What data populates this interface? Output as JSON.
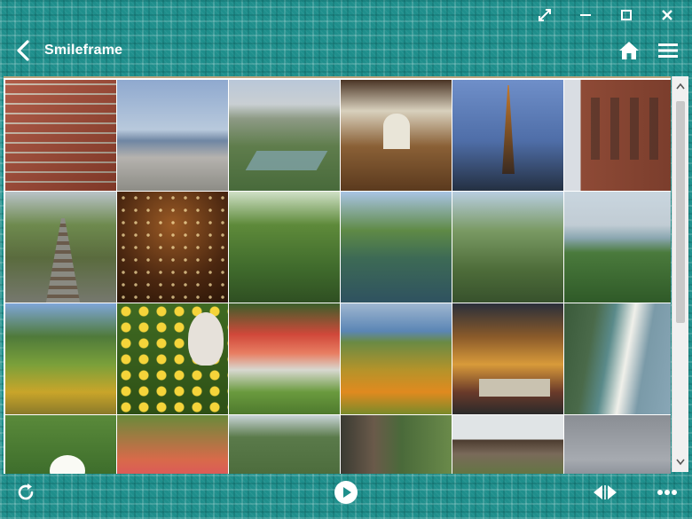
{
  "app": {
    "title": "Smileframe"
  },
  "window_controls": [
    {
      "name": "fullscreen-icon"
    },
    {
      "name": "minimize-icon"
    },
    {
      "name": "maximize-icon"
    },
    {
      "name": "close-icon"
    }
  ],
  "toolbar": [
    {
      "name": "home-icon"
    },
    {
      "name": "menu-icon"
    }
  ],
  "bottom_controls": [
    {
      "name": "refresh-icon"
    },
    {
      "name": "play-icon"
    },
    {
      "name": "prev-next-icon"
    },
    {
      "name": "more-icon"
    }
  ],
  "photos": [
    {
      "subject": "brick-wall"
    },
    {
      "subject": "city-bay-view"
    },
    {
      "subject": "star-fort-park"
    },
    {
      "subject": "wooden-hall-interior"
    },
    {
      "subject": "tv-tower-night"
    },
    {
      "subject": "red-brick-building"
    },
    {
      "subject": "railway-tracks"
    },
    {
      "subject": "lit-ceiling-interior"
    },
    {
      "subject": "forest-garden"
    },
    {
      "subject": "garden-pond"
    },
    {
      "subject": "weeping-tree"
    },
    {
      "subject": "coast-forest-view"
    },
    {
      "subject": "flower-bed-path"
    },
    {
      "subject": "yellow-flowers-rabbit"
    },
    {
      "subject": "flower-garden-lawn"
    },
    {
      "subject": "flower-field-sea"
    },
    {
      "subject": "street-cafe-night"
    },
    {
      "subject": "aerial-coastline"
    },
    {
      "subject": "white-lily"
    },
    {
      "subject": "red-flowers"
    },
    {
      "subject": "green-trees"
    },
    {
      "subject": "old-tree-trunk"
    },
    {
      "subject": "covered-walkway"
    },
    {
      "subject": "cloudy-sea"
    }
  ],
  "colors": {
    "frame": "#1f8f8c",
    "gallery_bg": "#ffffff",
    "icon": "#ffffff"
  }
}
